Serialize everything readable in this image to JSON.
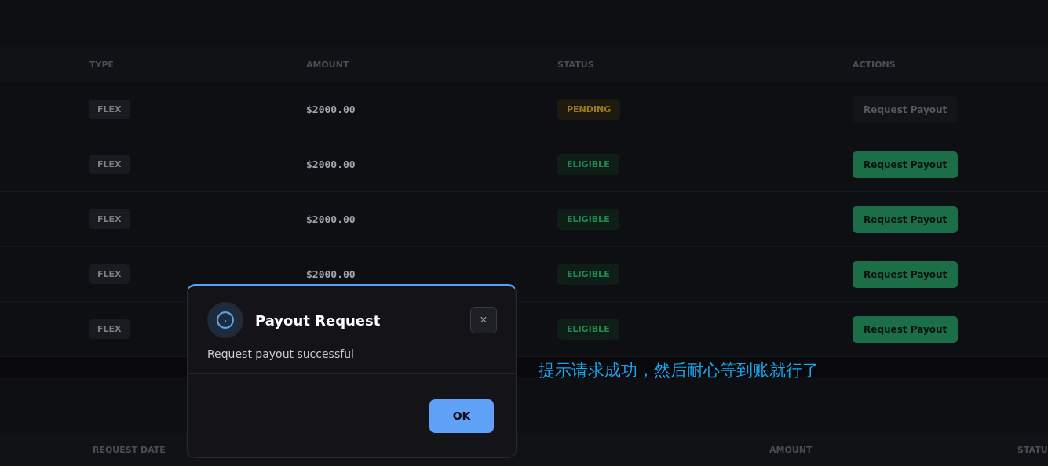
{
  "payouts_table": {
    "columns": [
      "TYPE",
      "AMOUNT",
      "STATUS",
      "ACTIONS"
    ],
    "rows": [
      {
        "type": "FLEX",
        "amount": "$2000.00",
        "status": {
          "label": "PENDING",
          "kind": "pending"
        },
        "action": {
          "label": "Request Payout",
          "disabled": true
        }
      },
      {
        "type": "FLEX",
        "amount": "$2000.00",
        "status": {
          "label": "ELIGIBLE",
          "kind": "eligible"
        },
        "action": {
          "label": "Request Payout",
          "disabled": false
        }
      },
      {
        "type": "FLEX",
        "amount": "$2000.00",
        "status": {
          "label": "ELIGIBLE",
          "kind": "eligible"
        },
        "action": {
          "label": "Request Payout",
          "disabled": false
        }
      },
      {
        "type": "FLEX",
        "amount": "$2000.00",
        "status": {
          "label": "ELIGIBLE",
          "kind": "eligible"
        },
        "action": {
          "label": "Request Payout",
          "disabled": false
        }
      },
      {
        "type": "FLEX",
        "status": {
          "label": "ELIGIBLE",
          "kind": "eligible"
        },
        "action": {
          "label": "Request Payout",
          "disabled": false
        }
      }
    ]
  },
  "annotation": "提示请求成功，然后耐心等到账就行了",
  "history_table": {
    "columns": [
      "REQUEST DATE",
      "AMOUNT",
      "STATU"
    ]
  },
  "dialog": {
    "title": "Payout Request",
    "message": "Request payout successful",
    "close": "×",
    "ok": "OK"
  }
}
